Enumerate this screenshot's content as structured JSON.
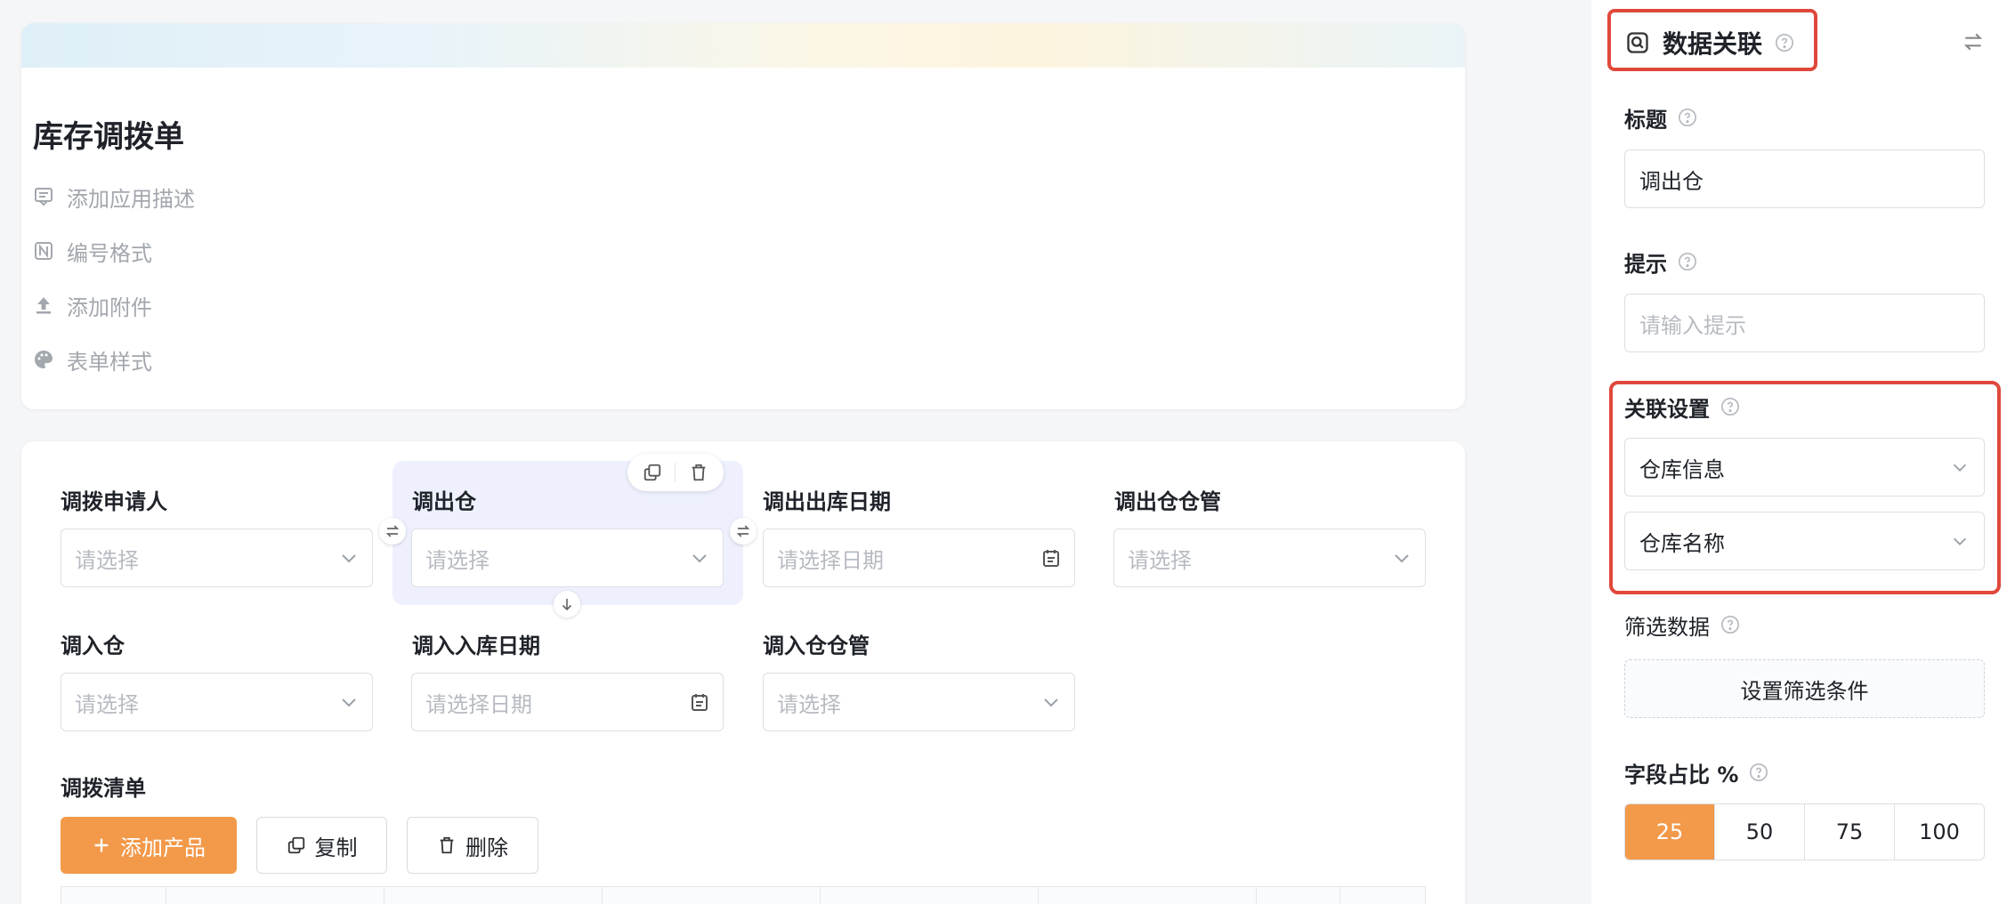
{
  "form_header": {
    "title": "库存调拨单",
    "meta": [
      {
        "icon": "comment-icon",
        "label": "添加应用描述"
      },
      {
        "icon": "number-format-icon",
        "label": "编号格式"
      },
      {
        "icon": "upload-icon",
        "label": "添加附件"
      },
      {
        "icon": "palette-icon",
        "label": "表单样式"
      }
    ]
  },
  "form": {
    "fields": [
      {
        "label": "调拨申请人",
        "placeholder": "请选择",
        "kind": "select"
      },
      {
        "label": "调出仓",
        "placeholder": "请选择",
        "kind": "select"
      },
      {
        "label": "调出出库日期",
        "placeholder": "请选择日期",
        "kind": "date"
      },
      {
        "label": "调出仓仓管",
        "placeholder": "请选择",
        "kind": "select"
      },
      {
        "label": "调入仓",
        "placeholder": "请选择",
        "kind": "select"
      },
      {
        "label": "调入入库日期",
        "placeholder": "请选择日期",
        "kind": "date"
      },
      {
        "label": "调入仓仓管",
        "placeholder": "请选择",
        "kind": "select"
      }
    ],
    "subtable": {
      "label": "调拨清单",
      "add_button": "添加产品",
      "copy_button": "复制",
      "delete_button": "删除"
    }
  },
  "panel": {
    "title": "数据关联",
    "title_label": "标题",
    "title_value": "调出仓",
    "hint_label": "提示",
    "hint_placeholder": "请输入提示",
    "assoc_label": "关联设置",
    "assoc_form": "仓库信息",
    "assoc_field": "仓库名称",
    "filter_label": "筛选数据",
    "filter_button": "设置筛选条件",
    "ratio_label": "字段占比 %",
    "ratio_options": [
      "25",
      "50",
      "75",
      "100"
    ],
    "ratio_selected": "25"
  },
  "colors": {
    "accent": "#f2994a",
    "highlight_border": "#e0483b",
    "selected_field_bg": "#eef1fd"
  }
}
